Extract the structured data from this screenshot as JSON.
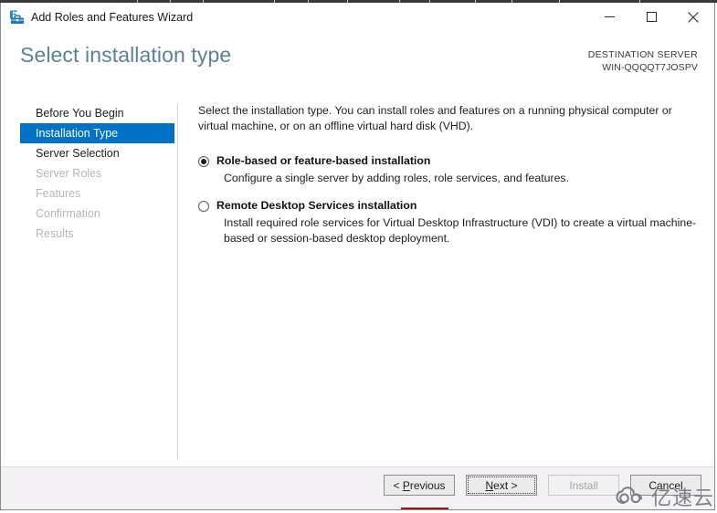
{
  "window": {
    "title": "Add Roles and Features Wizard",
    "icon": "toolbox-icon",
    "controls": {
      "minimize": "minimize-icon",
      "maximize": "maximize-icon",
      "close": "close-icon"
    }
  },
  "header": {
    "page_title": "Select installation type",
    "destination_label": "DESTINATION SERVER",
    "destination_server": "WIN-QQQQT7JOSPV"
  },
  "nav": {
    "items": [
      {
        "label": "Before You Begin",
        "state": "normal"
      },
      {
        "label": "Installation Type",
        "state": "selected"
      },
      {
        "label": "Server Selection",
        "state": "normal"
      },
      {
        "label": "Server Roles",
        "state": "disabled"
      },
      {
        "label": "Features",
        "state": "disabled"
      },
      {
        "label": "Confirmation",
        "state": "disabled"
      },
      {
        "label": "Results",
        "state": "disabled"
      }
    ]
  },
  "content": {
    "intro": "Select the installation type. You can install roles and features on a running physical computer or virtual machine, or on an offline virtual hard disk (VHD).",
    "options": [
      {
        "title": "Role-based or feature-based installation",
        "description": "Configure a single server by adding roles, role services, and features.",
        "selected": true
      },
      {
        "title": "Remote Desktop Services installation",
        "description": "Install required role services for Virtual Desktop Infrastructure (VDI) to create a virtual machine-based or session-based desktop deployment.",
        "selected": false
      }
    ]
  },
  "footer": {
    "buttons": [
      {
        "label": "< Previous",
        "accel": "P",
        "state": "enabled"
      },
      {
        "label": "Next >",
        "accel": "N",
        "state": "focused"
      },
      {
        "label": "Install",
        "accel": "",
        "state": "disabled"
      },
      {
        "label": "Cancel",
        "accel": "",
        "state": "enabled"
      }
    ]
  },
  "watermark": {
    "text": "亿速云",
    "icon": "cloud-logo-icon"
  },
  "colors": {
    "accent": "#0072c6",
    "title_text": "#5a8296",
    "footer_bg": "#f5f2f6"
  }
}
